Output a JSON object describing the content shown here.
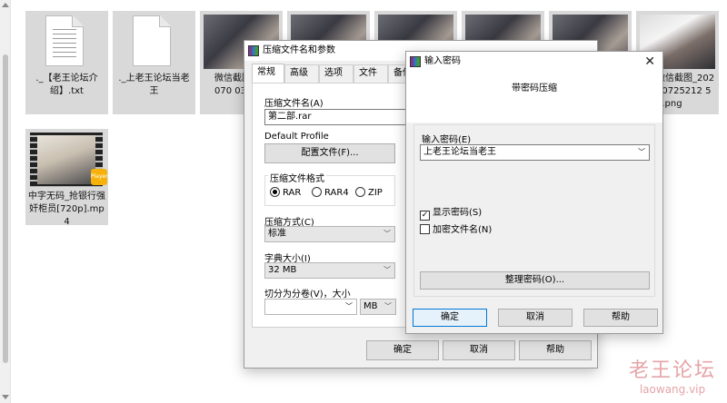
{
  "files": [
    {
      "name": "._【老王论坛介绍】.txt",
      "kind": "doc"
    },
    {
      "name": "._上老王论坛当老王",
      "kind": "doc"
    },
    {
      "name": "微信截图_2024070 033.p",
      "kind": "image"
    },
    {
      "name": "",
      "kind": "image"
    },
    {
      "name": "",
      "kind": "image"
    },
    {
      "name": "",
      "kind": "image"
    },
    {
      "name": "",
      "kind": "image"
    },
    {
      "name": "微信截图_20240725212 51.png",
      "kind": "image"
    },
    {
      "name": "中字无码_抢银行强奸柜员[720p].mp4",
      "kind": "video"
    }
  ],
  "video_badge": "Player",
  "compress_dialog": {
    "title": "压缩文件名和参数",
    "tabs": [
      "常规",
      "高级",
      "选项",
      "文件",
      "备份"
    ],
    "archive_name_label": "压缩文件名(A)",
    "archive_name_value": "第二部.rar",
    "profile_label": "Default Profile",
    "profile_button": "配置文件(F)...",
    "format_group_label": "压缩文件格式",
    "formats": [
      "RAR",
      "RAR4",
      "ZIP"
    ],
    "selected_format": "RAR",
    "method_label": "压缩方式(C)",
    "method_value": "标准",
    "dict_label": "字典大小(I)",
    "dict_value": "32 MB",
    "split_label": "切分为分卷(V)，大小",
    "split_value": "",
    "split_unit": "MB",
    "ok": "确定",
    "cancel": "取消",
    "help": "帮助"
  },
  "password_dialog": {
    "title": "输入密码",
    "subtitle": "带密码压缩",
    "password_label": "输入密码(E)",
    "password_value": "上老王论坛当老王",
    "show_password_label": "显示密码(S)",
    "show_password_checked": true,
    "encrypt_names_label": "加密文件名(N)",
    "encrypt_names_checked": false,
    "organize_button": "整理密码(O)...",
    "ok": "确定",
    "cancel": "取消",
    "help": "帮助"
  },
  "watermark": {
    "line1": "老王论坛",
    "line2": "laowang.vip"
  },
  "colors": {
    "accent": "#0078d7",
    "watermark": "#e6a4a8"
  }
}
